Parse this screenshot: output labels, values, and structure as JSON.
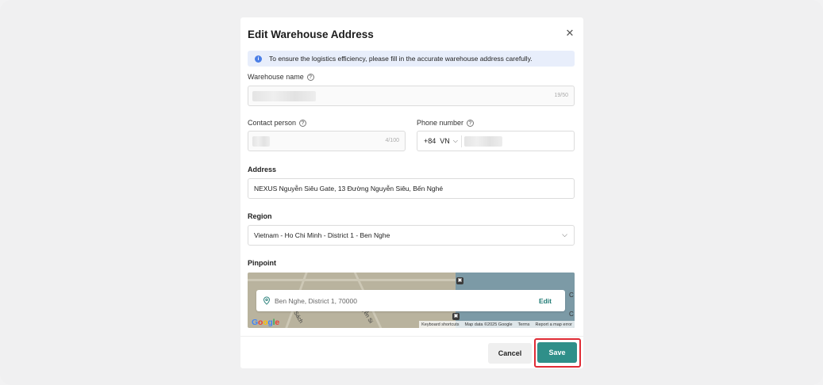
{
  "dialog": {
    "title": "Edit Warehouse Address",
    "close_icon": "close-icon"
  },
  "info_banner": {
    "icon": "info-icon",
    "text": "To ensure the logistics efficiency, please fill in the accurate warehouse address carefully."
  },
  "warehouse_name": {
    "label": "Warehouse name",
    "counter": "19/50"
  },
  "contact_person": {
    "label": "Contact person",
    "counter": "4/100"
  },
  "phone_number": {
    "label": "Phone number",
    "dial_code": "+84",
    "country": "VN"
  },
  "address": {
    "label": "Address",
    "value": "NEXUS Nguyễn Siêu Gate, 13 Đường Nguyễn Siêu, Bến Nghé"
  },
  "region": {
    "label": "Region",
    "value": "Vietnam - Ho Chi Minh - District 1 - Ben Nghe"
  },
  "pinpoint": {
    "label": "Pinpoint",
    "place": "Ben Nghe, District 1, 70000",
    "edit_label": "Edit",
    "street_1": "hi Sách",
    "street_2": "uyễn Si",
    "attribution": {
      "shortcuts": "Keyboard shortcuts",
      "map_data": "Map data ©2025 Google",
      "terms": "Terms",
      "report": "Report a map error"
    }
  },
  "footer": {
    "cancel_label": "Cancel",
    "save_label": "Save"
  },
  "colors": {
    "accent": "#2f8f89",
    "highlight": "#e02b35",
    "info": "#4a7ee6"
  }
}
